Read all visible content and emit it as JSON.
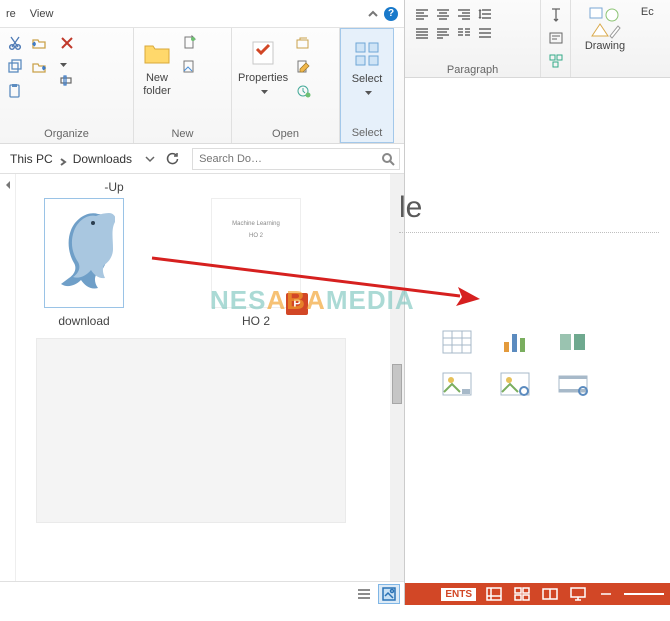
{
  "explorer": {
    "tabs": {
      "share_suffix": "re",
      "view": "View"
    },
    "ribbon": {
      "organize": {
        "label": "Organize",
        "cut": "cut-icon",
        "copy": "copy-icon",
        "paste": "paste-icon",
        "move_to": "move-to-icon",
        "copy_to": "copy-to-icon",
        "delete": "delete-icon",
        "rename": "rename-icon"
      },
      "new": {
        "label": "New",
        "new_folder": "New\nfolder",
        "new_item": "new-item-icon",
        "easy_access": "easy-access-icon"
      },
      "open": {
        "label": "Open",
        "properties": "Properties",
        "open_btn": "open-icon",
        "edit_btn": "edit-icon",
        "history_btn": "history-icon"
      },
      "select": {
        "label": "Select",
        "select_btn": "Select"
      }
    },
    "breadcrumb": {
      "root": "This PC",
      "folder": "Downloads"
    },
    "search_placeholder": "Search Do…",
    "up_label": "-Up",
    "files": [
      {
        "name": "download",
        "kind": "image"
      },
      {
        "name": "HO 2",
        "kind": "pptx",
        "slide_title": "Machine Learning",
        "slide_sub": "HO 2"
      }
    ]
  },
  "powerpoint": {
    "ribbon": {
      "paragraph_label": "Paragraph",
      "drawing_label": "Drawing",
      "editing_label": "Ec"
    },
    "slide": {
      "title_fragment": "le",
      "placeholders": [
        "table",
        "chart",
        "smartart",
        "picture",
        "online-picture",
        "video"
      ]
    },
    "status": {
      "comments_fragment": "ENTS",
      "buttons": [
        "normal-view",
        "slide-sorter",
        "reading-view",
        "slideshow",
        "zoom-out"
      ]
    }
  },
  "watermark": {
    "left": "NES",
    "mid": "ABA",
    "right": "MEDIA"
  }
}
